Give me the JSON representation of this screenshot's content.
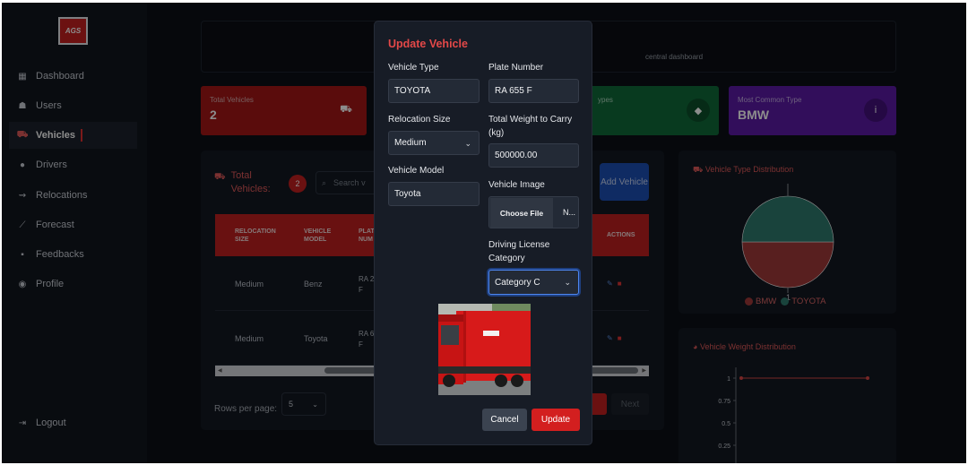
{
  "app": {
    "logo_text": "AGS"
  },
  "sidebar": {
    "items": [
      {
        "label": "Dashboard",
        "icon": "dashboard-icon"
      },
      {
        "label": "Users",
        "icon": "users-icon"
      },
      {
        "label": "Vehicles",
        "icon": "car-icon",
        "active": true
      },
      {
        "label": "Drivers",
        "icon": "driver-icon"
      },
      {
        "label": "Relocations",
        "icon": "route-icon"
      },
      {
        "label": "Forecast",
        "icon": "chart-line-icon"
      },
      {
        "label": "Feedbacks",
        "icon": "comment-icon"
      },
      {
        "label": "Profile",
        "icon": "user-circle-icon"
      }
    ],
    "logout_label": "Logout"
  },
  "header": {
    "subtitle": "central dashboard"
  },
  "stats": [
    {
      "label": "Total Vehicles",
      "value": "2",
      "color": "#a51616",
      "icon": "truck-icon"
    },
    {
      "label": "ypes",
      "value": "",
      "color": "#0f6b3a",
      "icon": "tags-icon"
    },
    {
      "label": "Most Common Type",
      "value": "BMW",
      "color": "#5b1aa6",
      "icon": "info-icon"
    }
  ],
  "table": {
    "title": "Total Vehicles:",
    "count": "2",
    "search_placeholder": "Search v",
    "add_button": "Add Vehicle",
    "columns": [
      "RELOCATION SIZE",
      "VEHICLE MODEL",
      "PLAT NUM",
      "ACTIONS"
    ],
    "rows": [
      {
        "size": "Medium",
        "model": "Benz",
        "plate": "RA 2 F"
      },
      {
        "size": "Medium",
        "model": "Toyota",
        "plate": "RA 6 F"
      }
    ],
    "rows_per_page_label": "Rows per page:",
    "rows_per_page_value": "5",
    "next_label": "Next"
  },
  "charts": {
    "type_title": "Vehicle Type Distribution",
    "weight_title": "Vehicle Weight Distribution"
  },
  "chart_data": [
    {
      "type": "pie",
      "title": "Vehicle Type Distribution",
      "labels": [
        "BMW",
        "TOYOTA"
      ],
      "values": [
        1,
        1
      ],
      "colors": [
        "#a03a3a",
        "#2f7a6e"
      ],
      "legend": "bottom"
    },
    {
      "type": "line",
      "title": "Vehicle Weight Distribution",
      "y_ticks": [
        "1",
        "0.75",
        "0.5",
        "0.25"
      ],
      "series": [
        {
          "values": [
            1,
            1
          ]
        }
      ],
      "color": "#d94545"
    }
  ],
  "modal": {
    "title": "Update Vehicle",
    "vehicle_type_label": "Vehicle Type",
    "vehicle_type_value": "TOYOTA",
    "plate_label": "Plate Number",
    "plate_value": "RA 655 F",
    "relocation_label": "Relocation Size",
    "relocation_value": "Medium",
    "weight_label_1": "Total Weight to Carry",
    "weight_label_2": "(kg)",
    "weight_value": "500000.00",
    "model_label": "Vehicle Model",
    "model_value": "Toyota",
    "image_label": "Vehicle Image",
    "choose_file": "Choose File",
    "file_name": "N...",
    "license_label_1": "Driving License",
    "license_label_2": "Category",
    "license_value": "Category C",
    "cancel": "Cancel",
    "update": "Update"
  }
}
